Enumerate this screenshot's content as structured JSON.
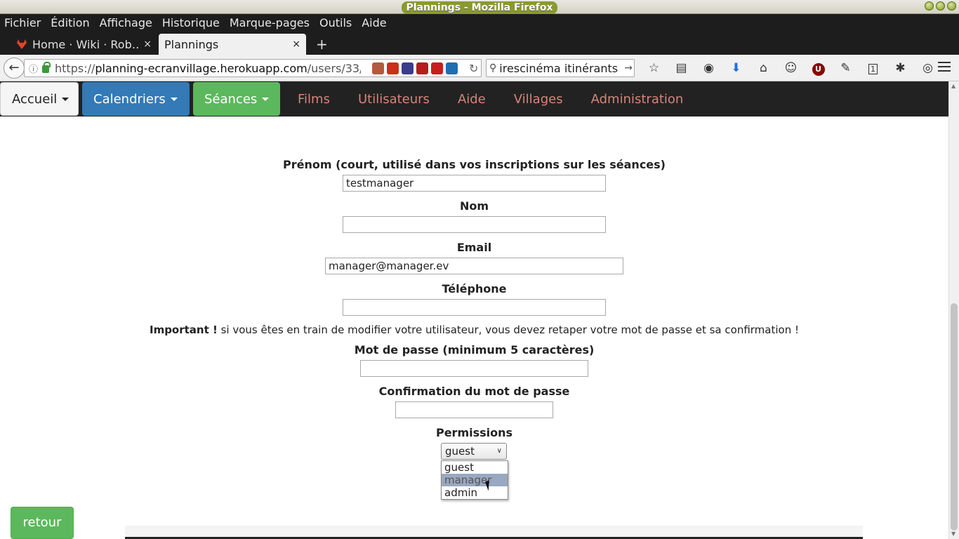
{
  "window": {
    "title": "Plannings - Mozilla Firefox"
  },
  "menubar": {
    "items": [
      "Fichier",
      "Édition",
      "Affichage",
      "Historique",
      "Marque-pages",
      "Outils",
      "Aide"
    ]
  },
  "tabs": [
    {
      "label": "Home · Wiki · Rob…",
      "icon": "gitlab-icon",
      "close": "×"
    },
    {
      "label": "Plannings",
      "close": "×"
    }
  ],
  "new_tab": "+",
  "navbar": {
    "back_glyph": "←",
    "url_prefix": "https://",
    "url_host": "planning-ecranvillage.herokuapp.com",
    "url_path": "/users/33/",
    "search_value": "Cinéma itinérants",
    "search_value_shown": "irescinéma itinérants",
    "extension_colors": [
      "#b45a3c",
      "#c83218",
      "#3c3c8c",
      "#b41e1e",
      "#c81e1e",
      "#1e6eb4"
    ],
    "accent_download": "#1e6fd8",
    "ublock_color": "#8b0000",
    "counter_badge": "1",
    "ublock_letter": "U"
  },
  "app_nav": {
    "accueil": "Accueil",
    "calendriers": "Calendriers",
    "seances": "Séances",
    "links": [
      "Films",
      "Utilisateurs",
      "Aide",
      "Villages",
      "Administration"
    ],
    "colors": {
      "primary": "#337ab7",
      "success": "#5cb85c",
      "link": "#d9837a",
      "bar": "#222222"
    }
  },
  "form": {
    "prenom_label": "Prénom (court, utilisé dans vos inscriptions sur les séances)",
    "prenom_value": "testmanager",
    "nom_label": "Nom",
    "nom_value": "",
    "email_label": "Email",
    "email_value": "manager@manager.ev",
    "telephone_label": "Téléphone",
    "telephone_value": "",
    "notice_strong": "Important !",
    "notice_text": " si vous êtes en train de modifier votre utilisateur, vous devez retaper votre mot de passe et sa confirmation !",
    "password_label": "Mot de passe (minimum 5 caractères)",
    "password_value": "",
    "confirm_label": "Confirmation du mot de passe",
    "confirm_value": "",
    "permissions_label": "Permissions",
    "permissions_selected": "guest",
    "permissions_options": [
      "guest",
      "manager",
      "admin"
    ],
    "permissions_hovered": "manager"
  },
  "back_button": "retour"
}
